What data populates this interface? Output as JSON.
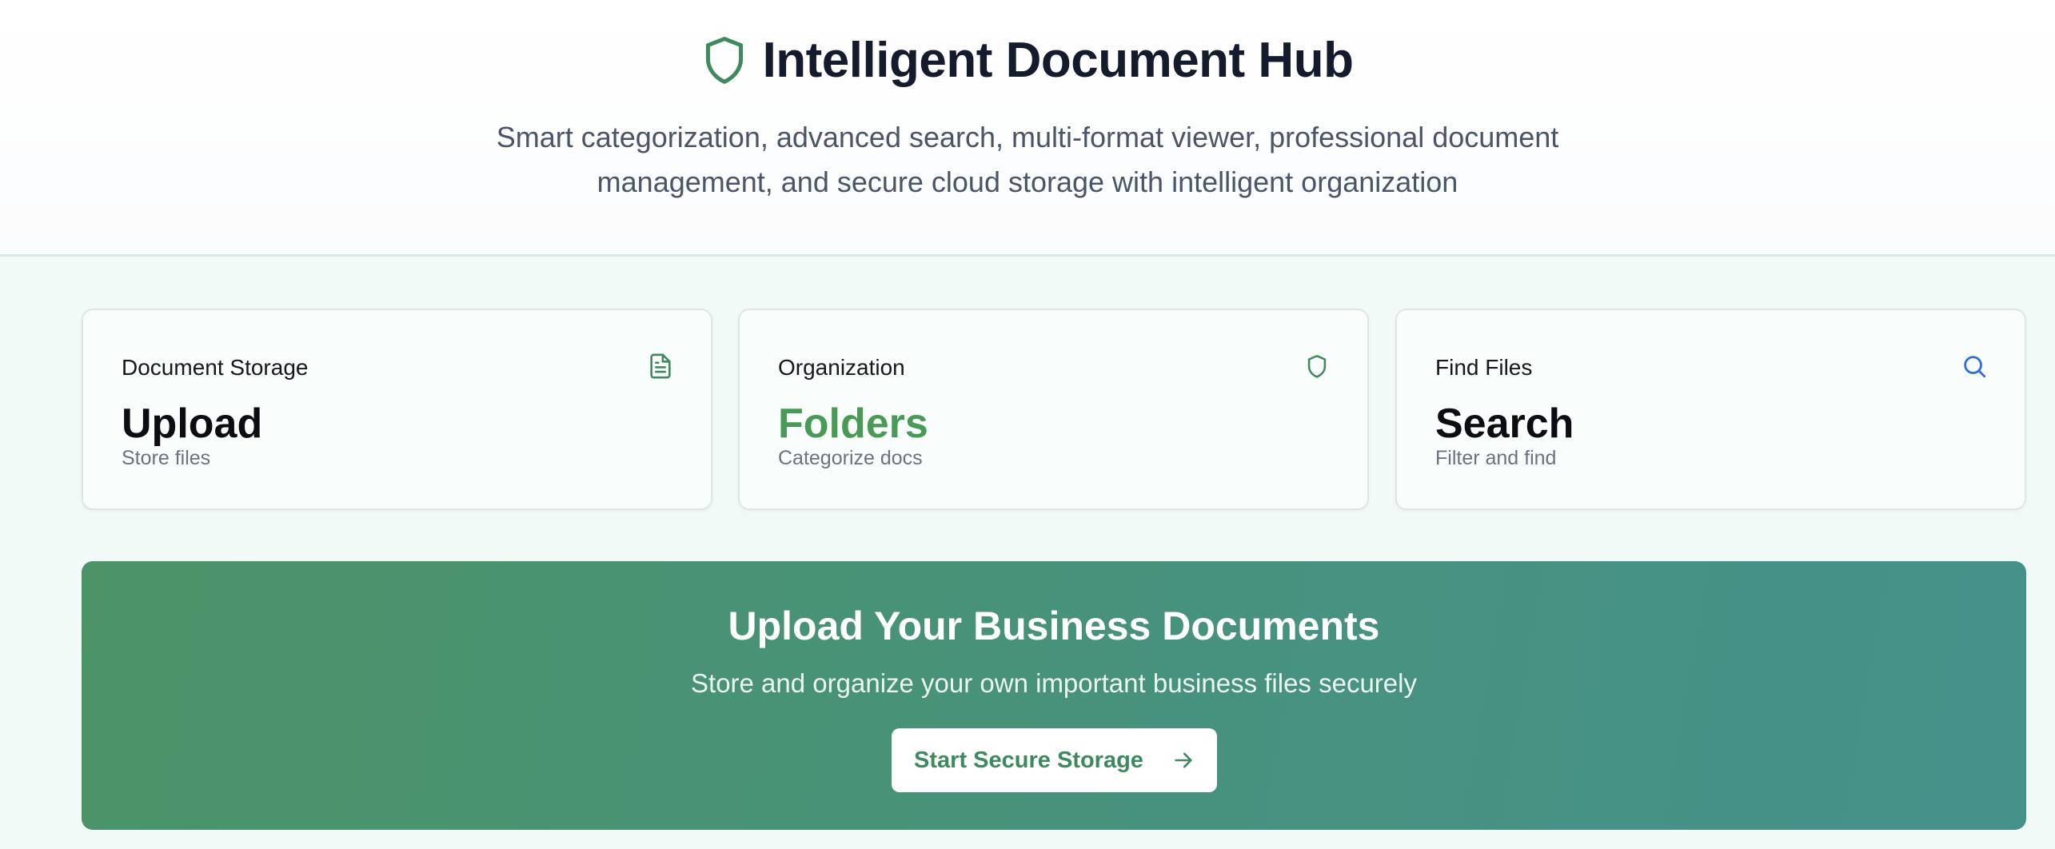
{
  "header": {
    "title": "Intelligent Document Hub",
    "logo_icon": "shield-icon",
    "subtitle": "Smart categorization, advanced search, multi-format viewer, professional document management, and secure cloud storage with intelligent organization"
  },
  "cards": [
    {
      "label": "Document Storage",
      "icon": "file-text-icon",
      "icon_color": "#3e8a5c",
      "value": "Upload",
      "description": "Store files"
    },
    {
      "label": "Organization",
      "icon": "shield-icon",
      "icon_color": "#3e8a5c",
      "value": "Folders",
      "value_color": "#4a9a57",
      "description": "Categorize docs"
    },
    {
      "label": "Find Files",
      "icon": "search-icon",
      "icon_color": "#2f6fd6",
      "value": "Search",
      "description": "Filter and find"
    }
  ],
  "banner": {
    "title": "Upload Your Business Documents",
    "subtitle": "Store and organize your own important business files securely",
    "cta_label": "Start Secure Storage",
    "cta_icon": "arrow-right-icon"
  },
  "colors": {
    "accent_green": "#4a9a57",
    "banner_start": "#4b9367",
    "banner_end": "#46918a",
    "title_text": "#141b2d"
  }
}
